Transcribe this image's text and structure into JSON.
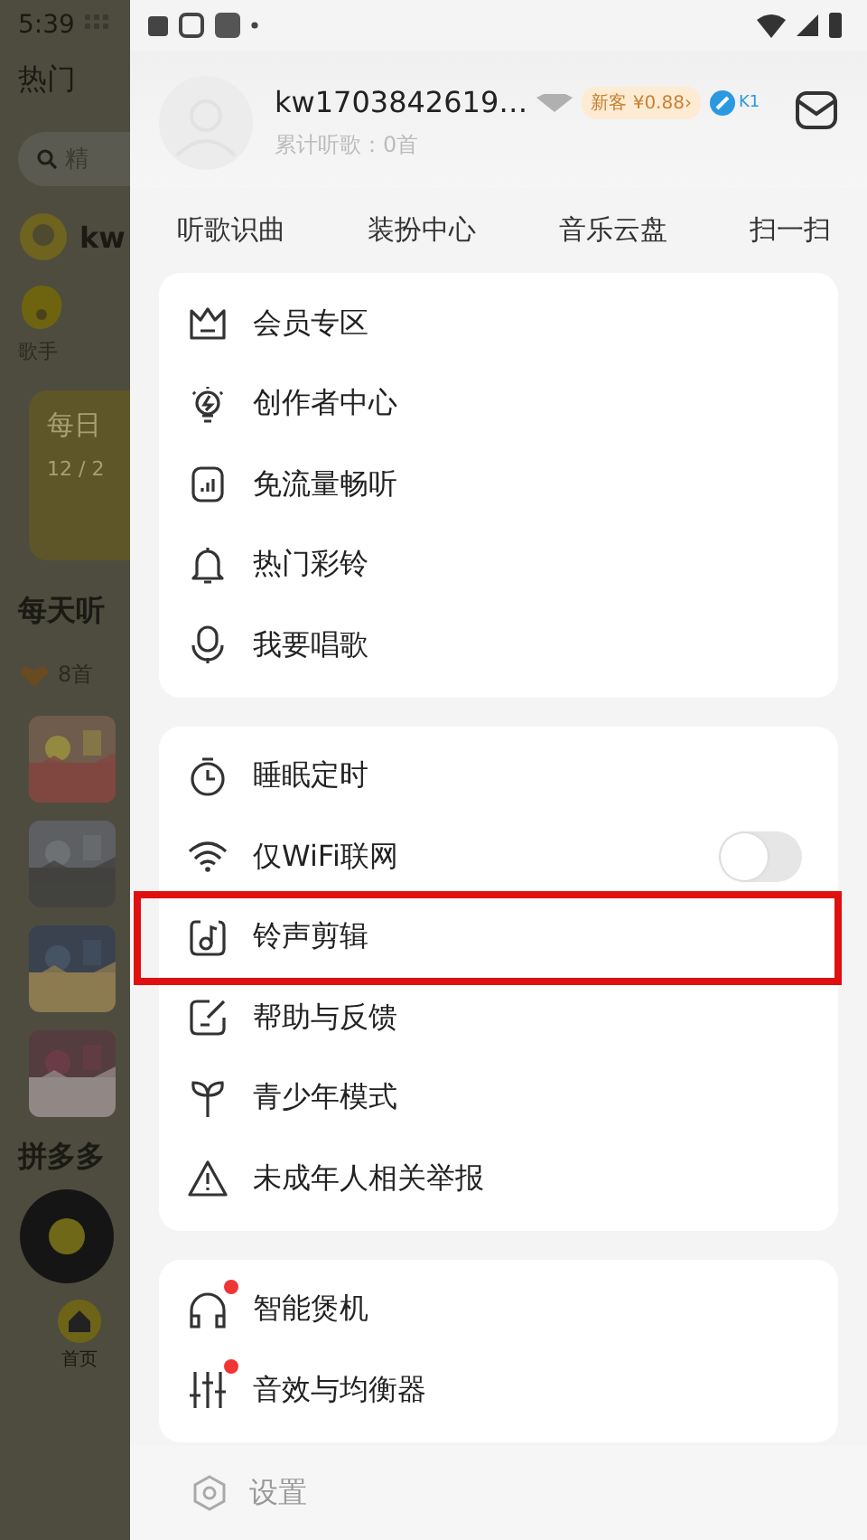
{
  "background_app": {
    "status_time": "5:39",
    "tab": "热门",
    "search_placeholder": "精",
    "user_name": "kw",
    "category": "歌手",
    "card_title": "每日",
    "card_date": "12 / 2",
    "section_title": "每天听",
    "song_count": "8首",
    "section_title_2": "拼多多",
    "nav_label": "首页"
  },
  "drawer": {
    "user": {
      "name": "kw1703842619…",
      "subtitle": "累计听歌：0首",
      "promo": "新客 ¥0.88›",
      "level": "K1"
    },
    "quick_links": [
      "听歌识曲",
      "装扮中心",
      "音乐云盘",
      "扫一扫"
    ],
    "groups": [
      {
        "items": [
          {
            "label": "会员专区",
            "kind": "crown",
            "dot": false,
            "highlighted": false
          },
          {
            "label": "创作者中心",
            "kind": "bulb",
            "dot": false,
            "highlighted": false
          },
          {
            "label": "免流量畅听",
            "kind": "chart",
            "dot": false,
            "highlighted": false
          },
          {
            "label": "热门彩铃",
            "kind": "bell",
            "dot": false,
            "highlighted": false
          },
          {
            "label": "我要唱歌",
            "kind": "mic",
            "dot": false,
            "highlighted": false
          }
        ]
      },
      {
        "items": [
          {
            "label": "睡眠定时",
            "kind": "timer",
            "dot": false,
            "highlighted": false
          },
          {
            "label": "仅WiFi联网",
            "kind": "wifi",
            "switch": {
              "on": false
            },
            "dot": false,
            "highlighted": false
          },
          {
            "label": "铃声剪辑",
            "kind": "ringtone",
            "dot": false,
            "highlighted": true
          },
          {
            "label": "帮助与反馈",
            "kind": "feedback",
            "dot": false,
            "highlighted": false
          },
          {
            "label": "青少年模式",
            "kind": "sprout",
            "dot": false,
            "highlighted": false
          },
          {
            "label": "未成年人相关举报",
            "kind": "warning",
            "dot": false,
            "highlighted": false
          }
        ]
      },
      {
        "items": [
          {
            "label": "智能煲机",
            "kind": "headphones",
            "dot": true,
            "highlighted": false
          },
          {
            "label": "音效与均衡器",
            "kind": "equalizer",
            "dot": true,
            "highlighted": false
          }
        ]
      }
    ],
    "settings": "设置"
  }
}
